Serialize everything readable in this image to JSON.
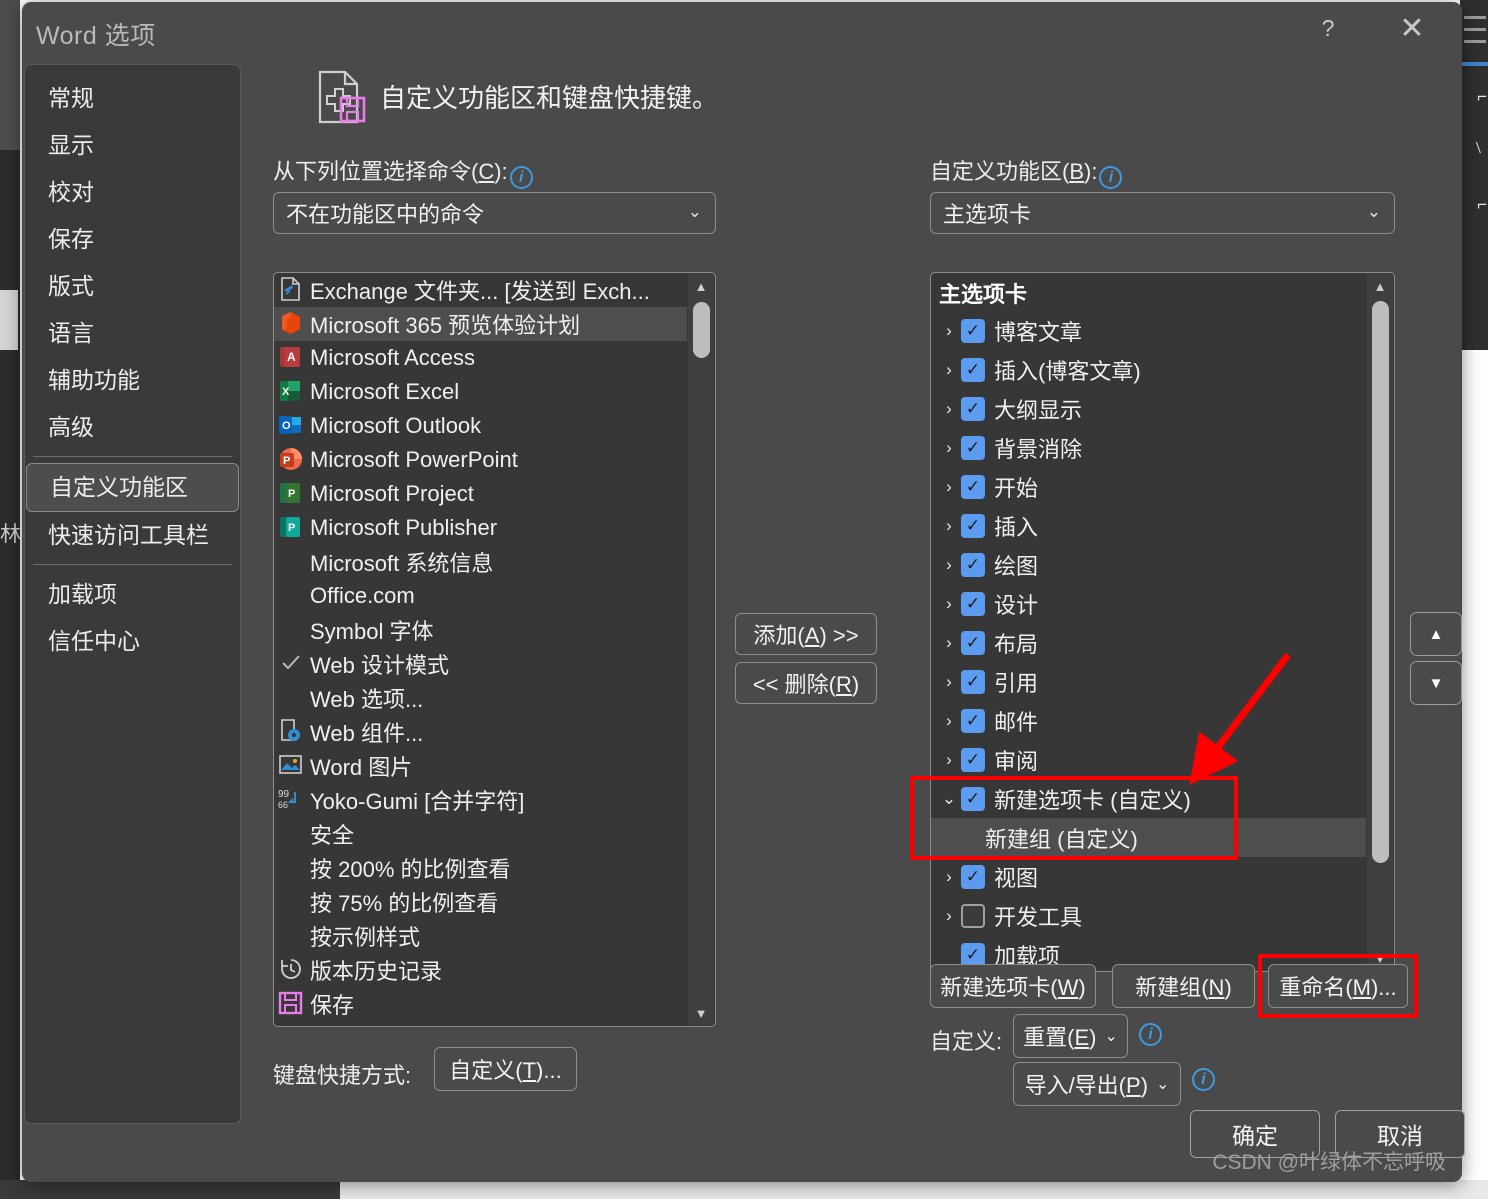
{
  "window": {
    "title": "Word 选项",
    "help_icon": "?",
    "close_icon": "✕"
  },
  "sidebar": {
    "items": [
      {
        "label": "常规",
        "selected": false
      },
      {
        "label": "显示",
        "selected": false
      },
      {
        "label": "校对",
        "selected": false
      },
      {
        "label": "保存",
        "selected": false
      },
      {
        "label": "版式",
        "selected": false
      },
      {
        "label": "语言",
        "selected": false
      },
      {
        "label": "辅助功能",
        "selected": false
      },
      {
        "label": "高级",
        "selected": false
      },
      {
        "label": "自定义功能区",
        "selected": true
      },
      {
        "label": "快速访问工具栏",
        "selected": false
      },
      {
        "label": "加载项",
        "selected": false
      },
      {
        "label": "信任中心",
        "selected": false
      }
    ]
  },
  "header": {
    "title": "自定义功能区和键盘快捷键。",
    "icon": "customize-ribbon-icon"
  },
  "left_panel": {
    "label": "从下列位置选择命令(C):",
    "label_accel": "C",
    "info_icon": "i",
    "combo_value": "不在功能区中的命令",
    "chevron": "⌄",
    "commands": [
      {
        "text": "Exchange 文件夹... [发送到 Exch...",
        "icon": "exchange-folder-icon",
        "selected": false
      },
      {
        "text": "Microsoft 365 预览体验计划",
        "icon": "office-365-icon",
        "selected": true
      },
      {
        "text": "Microsoft Access",
        "icon": "access-icon",
        "selected": false
      },
      {
        "text": "Microsoft Excel",
        "icon": "excel-icon",
        "selected": false
      },
      {
        "text": "Microsoft Outlook",
        "icon": "outlook-icon",
        "selected": false
      },
      {
        "text": "Microsoft PowerPoint",
        "icon": "powerpoint-icon",
        "selected": false
      },
      {
        "text": "Microsoft Project",
        "icon": "project-icon",
        "selected": false
      },
      {
        "text": "Microsoft Publisher",
        "icon": "publisher-icon",
        "selected": false
      },
      {
        "text": "Microsoft 系统信息",
        "icon": "none",
        "selected": false
      },
      {
        "text": "Office.com",
        "icon": "none",
        "selected": false
      },
      {
        "text": "Symbol 字体",
        "icon": "none",
        "selected": false
      },
      {
        "text": "Web 设计模式",
        "icon": "check-icon",
        "selected": false
      },
      {
        "text": "Web 选项...",
        "icon": "none",
        "selected": false
      },
      {
        "text": "Web 组件...",
        "icon": "web-component-icon",
        "selected": false
      },
      {
        "text": "Word 图片",
        "icon": "picture-icon",
        "selected": false
      },
      {
        "text": "Yoko-Gumi [合并字符]",
        "icon": "yoko-gumi-icon",
        "selected": false
      },
      {
        "text": "安全",
        "icon": "none",
        "selected": false
      },
      {
        "text": "按 200% 的比例查看",
        "icon": "none",
        "selected": false
      },
      {
        "text": "按 75% 的比例查看",
        "icon": "none",
        "selected": false
      },
      {
        "text": "按示例样式",
        "icon": "none",
        "selected": false
      },
      {
        "text": "版本历史记录",
        "icon": "history-icon",
        "selected": false
      },
      {
        "text": "保存",
        "icon": "save-icon",
        "selected": false
      }
    ]
  },
  "middle": {
    "add_label": "添加(A) >>",
    "add_accel": "A",
    "remove_label": "<< 删除(R)",
    "remove_accel": "R"
  },
  "right_panel": {
    "label": "自定义功能区(B):",
    "label_accel": "B",
    "info_icon": "i",
    "combo_value": "主选项卡",
    "chevron": "⌄",
    "tree_root": "主选项卡",
    "tree": [
      {
        "label": "博客文章",
        "checked": true,
        "twisty": "›",
        "indent": 0,
        "selected": false,
        "highlighted": false
      },
      {
        "label": "插入(博客文章)",
        "checked": true,
        "twisty": "›",
        "indent": 0,
        "selected": false,
        "highlighted": false
      },
      {
        "label": "大纲显示",
        "checked": true,
        "twisty": "›",
        "indent": 0,
        "selected": false,
        "highlighted": false
      },
      {
        "label": "背景消除",
        "checked": true,
        "twisty": "›",
        "indent": 0,
        "selected": false,
        "highlighted": false
      },
      {
        "label": "开始",
        "checked": true,
        "twisty": "›",
        "indent": 0,
        "selected": false,
        "highlighted": false
      },
      {
        "label": "插入",
        "checked": true,
        "twisty": "›",
        "indent": 0,
        "selected": false,
        "highlighted": false
      },
      {
        "label": "绘图",
        "checked": true,
        "twisty": "›",
        "indent": 0,
        "selected": false,
        "highlighted": false
      },
      {
        "label": "设计",
        "checked": true,
        "twisty": "›",
        "indent": 0,
        "selected": false,
        "highlighted": false
      },
      {
        "label": "布局",
        "checked": true,
        "twisty": "›",
        "indent": 0,
        "selected": false,
        "highlighted": false
      },
      {
        "label": "引用",
        "checked": true,
        "twisty": "›",
        "indent": 0,
        "selected": false,
        "highlighted": false
      },
      {
        "label": "邮件",
        "checked": true,
        "twisty": "›",
        "indent": 0,
        "selected": false,
        "highlighted": false
      },
      {
        "label": "审阅",
        "checked": true,
        "twisty": "›",
        "indent": 0,
        "selected": false,
        "highlighted": false
      },
      {
        "label": "新建选项卡 (自定义)",
        "checked": true,
        "twisty": "⌄",
        "indent": 0,
        "selected": false,
        "highlighted": true
      },
      {
        "label": "新建组 (自定义)",
        "checked": null,
        "twisty": "",
        "indent": 1,
        "selected": true,
        "highlighted": true
      },
      {
        "label": "视图",
        "checked": true,
        "twisty": "›",
        "indent": 0,
        "selected": false,
        "highlighted": false
      },
      {
        "label": "开发工具",
        "checked": false,
        "twisty": "›",
        "indent": 0,
        "selected": false,
        "highlighted": false
      },
      {
        "label": "加载项",
        "checked": true,
        "twisty": "",
        "indent": 0,
        "selected": false,
        "highlighted": false
      }
    ],
    "buttons": [
      {
        "label": "新建选项卡(W)",
        "accel": "W",
        "highlighted": false
      },
      {
        "label": "新建组(N)",
        "accel": "N",
        "highlighted": false
      },
      {
        "label": "重命名(M)...",
        "accel": "M",
        "highlighted": true
      }
    ],
    "customize_label": "自定义:",
    "reset_label": "重置(E)",
    "reset_accel": "E",
    "import_export_label": "导入/导出(P)",
    "import_export_accel": "P",
    "move_up_icon": "▲",
    "move_down_icon": "▼"
  },
  "footer": {
    "keyboard_label": "键盘快捷方式:",
    "keyboard_button": "自定义(T)...",
    "keyboard_accel": "T",
    "ok_label": "确定",
    "cancel_label": "取消"
  },
  "watermark": "CSDN @叶绿体不忘呼吸",
  "colors": {
    "dialog_bg": "#4a4a4a",
    "panel_bg": "#373737",
    "accent_checkbox": "#5b9bf0",
    "highlight_red": "#fe0000",
    "info_blue": "#3e9ae0"
  }
}
